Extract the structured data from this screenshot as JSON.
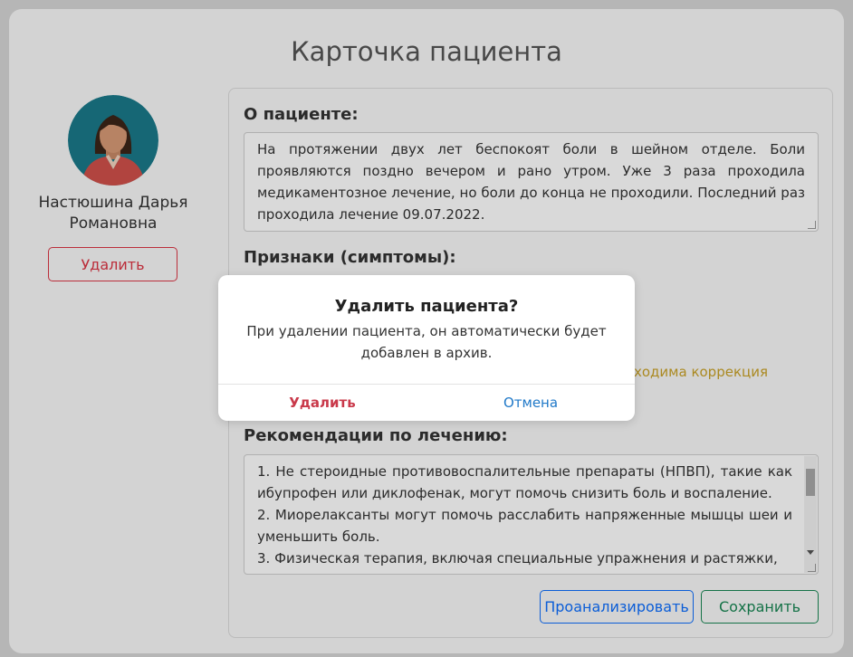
{
  "page": {
    "title": "Карточка пациента"
  },
  "patient": {
    "name_line1": "Настюшина Дарья",
    "name_line2": "Романовна",
    "delete_label": "Удалить"
  },
  "about": {
    "label": "О пациенте:",
    "text": "На протяжении двух лет беспокоят боли в шейном отделе. Боли проявляются поздно вечером и рано утром. Уже 3 раза проходила медикаментозное лечение, но боли до конца не проходили. Последний раз проходила лечение 09.07.2022."
  },
  "symptoms": {
    "label": "Признаки (симптомы):",
    "partial_visible": "ходима коррекция"
  },
  "recommendations": {
    "label": "Рекомендации по лечению:",
    "items": [
      "1. Не стероидные противовоспалительные препараты (НПВП), такие как ибупрофен или диклофенак, могут помочь снизить боль и воспаление.",
      "2. Миорелаксанты могут помочь расслабить напряженные мышцы шеи и уменьшить боль.",
      "3. Физическая терапия, включая специальные упражнения и растяжки,"
    ]
  },
  "actions": {
    "analyze_label": "Проанализировать",
    "save_label": "Сохранить"
  },
  "modal": {
    "title": "Удалить пациента?",
    "message": "При удалении пациента, он автоматически будет добавлен в архив.",
    "confirm_label": "Удалить",
    "cancel_label": "Отмена"
  },
  "colors": {
    "danger": "#dc3545",
    "primary": "#0d6efd",
    "success": "#198754",
    "warning_text": "#c9a227",
    "avatar_bg": "#1b7a8a"
  }
}
